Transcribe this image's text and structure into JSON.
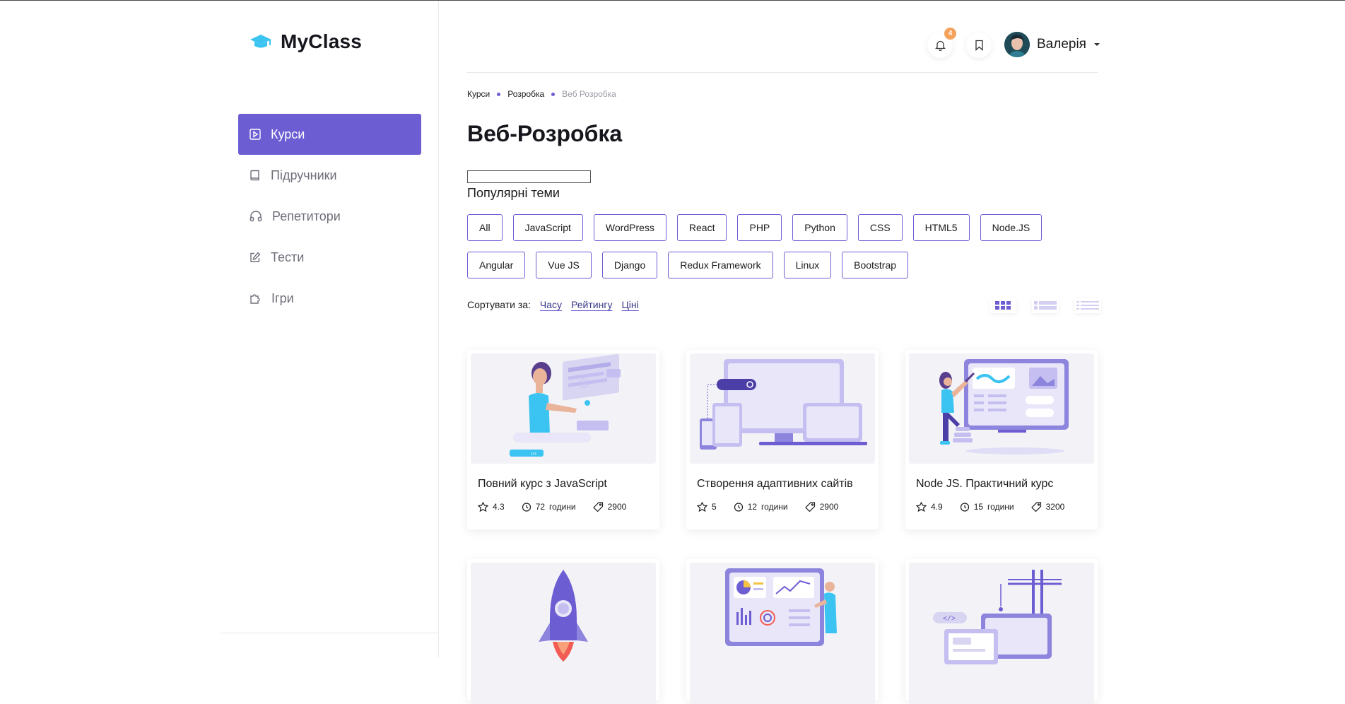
{
  "app": {
    "name": "MyClass"
  },
  "sidebar": {
    "items": [
      {
        "label": "Курси",
        "icon": "play-square-icon",
        "active": true
      },
      {
        "label": "Підручники",
        "icon": "book-icon",
        "active": false
      },
      {
        "label": "Репетитори",
        "icon": "headphones-icon",
        "active": false
      },
      {
        "label": "Тести",
        "icon": "edit-icon",
        "active": false
      },
      {
        "label": "Ігри",
        "icon": "puzzle-icon",
        "active": false
      }
    ]
  },
  "header": {
    "notifications_count": "4",
    "user_name": "Валерія"
  },
  "breadcrumb": [
    "Курси",
    "Розробка",
    "Веб Розробка"
  ],
  "page": {
    "title": "Веб-Розробка",
    "topics_title": "Популярні теми"
  },
  "tags": {
    "row1": [
      "All",
      "JavaScript",
      "WordPress",
      "React",
      "PHP",
      "Python",
      "CSS",
      "HTML5",
      "Node.JS"
    ],
    "row2": [
      "Angular",
      "Vue JS",
      "Django",
      "Redux Framework",
      "Linux",
      "Bootstrap"
    ]
  },
  "sort": {
    "label": "Сортувати за:",
    "options": [
      "Часу",
      "Рейтингу",
      "Ціні"
    ]
  },
  "courses": [
    {
      "title": "Повний курс з JavaScript",
      "rating": "4.3",
      "hours": "72",
      "hours_label": "години",
      "price": "2900"
    },
    {
      "title": "Створення адаптивних сайтів",
      "rating": "5",
      "hours": "12",
      "hours_label": "години",
      "price": "2900"
    },
    {
      "title": "Node JS. Практичний курс",
      "rating": "4.9",
      "hours": "15",
      "hours_label": "години",
      "price": "3200"
    }
  ],
  "colors": {
    "accent": "#6c5dd3",
    "badge": "#f4a25a",
    "logo_icon": "#3bc4f2"
  }
}
